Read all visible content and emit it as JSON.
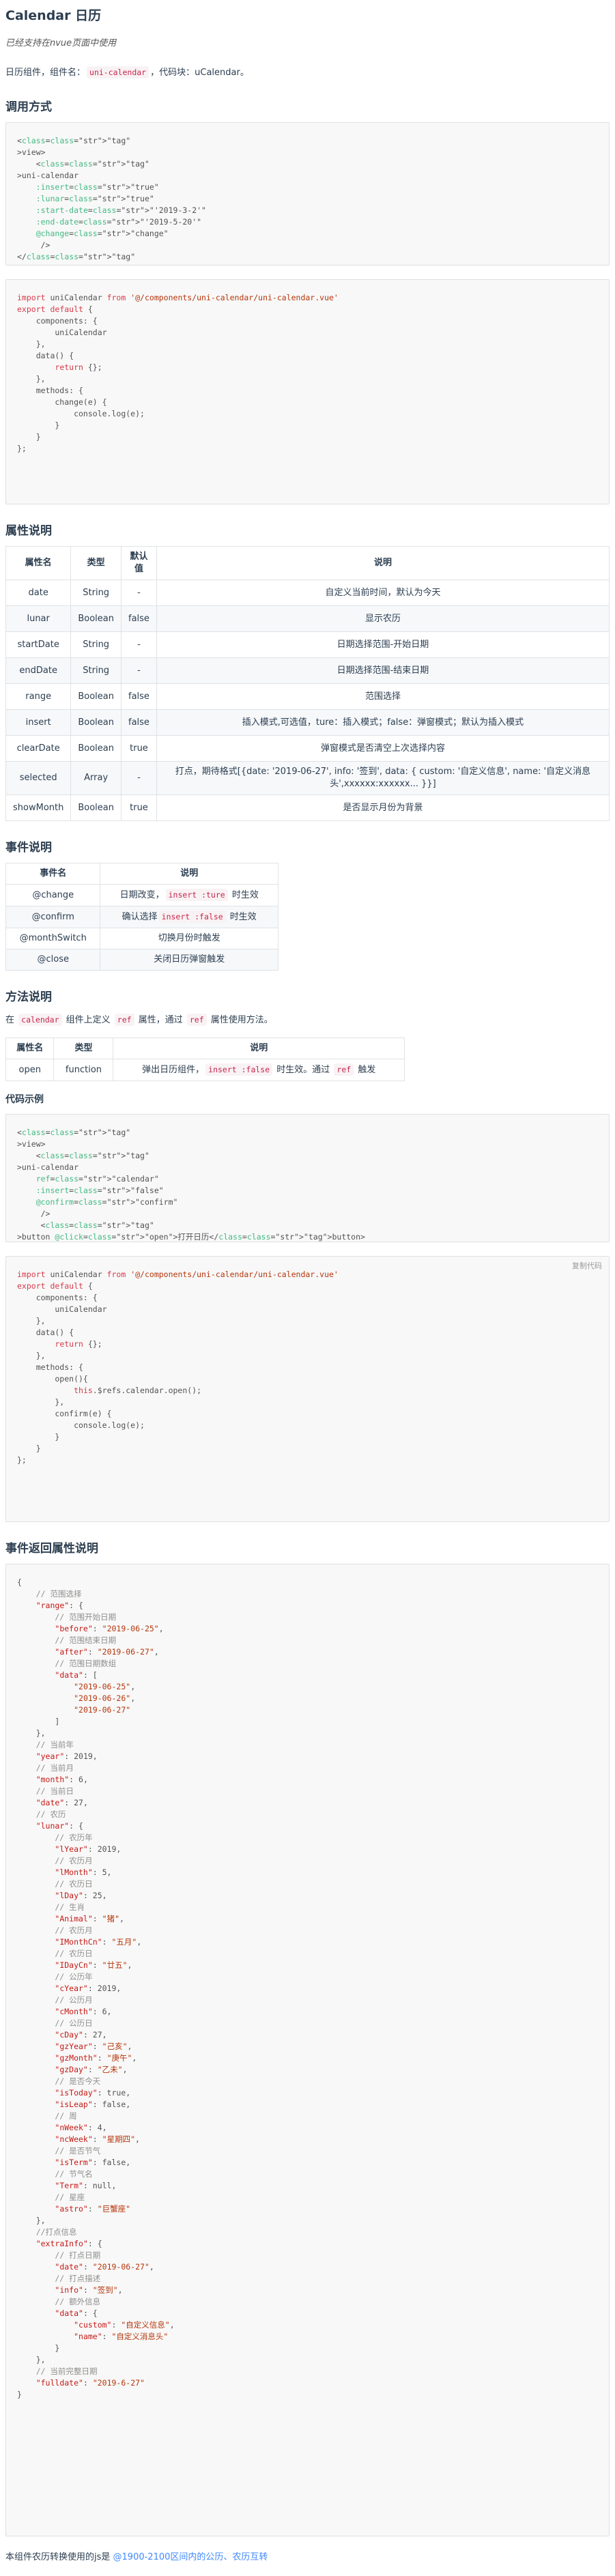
{
  "title": "Calendar 日历",
  "subtitle": "已经支持在nvue页面中使用",
  "intro": {
    "text1": "日历组件，组件名：",
    "comp_name": "uni-calendar",
    "text2": "，代码块：",
    "snippet": "uCalendar",
    "text3": "。"
  },
  "section_usage": "调用方式",
  "usage_template_lines": [
    "<view>",
    "    <uni-calendar",
    "    :insert=\"true\"",
    "    :lunar=\"true\"",
    "    :start-date=\"'2019-3-2'\"",
    "    :end-date=\"'2019-5-20'\"",
    "    @change=\"change\"",
    "     />",
    "</view>"
  ],
  "usage_script_lines": [
    "import uniCalendar from '@/components/uni-calendar/uni-calendar.vue'",
    "export default {",
    "    components: {",
    "        uniCalendar",
    "    },",
    "    data() {",
    "        return {};",
    "    },",
    "    methods: {",
    "        change(e) {",
    "            console.log(e);",
    "        }",
    "    }",
    "};"
  ],
  "section_props": "属性说明",
  "props_headers": [
    "属性名",
    "类型",
    "默认值",
    "说明"
  ],
  "props_rows": [
    [
      "date",
      "String",
      "-",
      "自定义当前时间，默认为今天"
    ],
    [
      "lunar",
      "Boolean",
      "false",
      "显示农历"
    ],
    [
      "startDate",
      "String",
      "-",
      "日期选择范围-开始日期"
    ],
    [
      "endDate",
      "String",
      "-",
      "日期选择范围-结束日期"
    ],
    [
      "range",
      "Boolean",
      "false",
      "范围选择"
    ],
    [
      "insert",
      "Boolean",
      "false",
      "插入模式,可选值，ture：插入模式；false：弹窗模式；默认为插入模式"
    ],
    [
      "clearDate",
      "Boolean",
      "true",
      "弹窗模式是否清空上次选择内容"
    ],
    [
      "selected",
      "Array",
      "-",
      "打点，期待格式[{date: '2019-06-27', info: '签到', data: { custom: '自定义信息', name: '自定义消息头',xxxxxx:xxxxxx... }}]"
    ],
    [
      "showMonth",
      "Boolean",
      "true",
      "是否显示月份为背景"
    ]
  ],
  "section_events": "事件说明",
  "events_headers": [
    "事件名",
    "说明"
  ],
  "events_rows": [
    {
      "name": "@change",
      "pre": "日期改变，",
      "code": "insert :ture",
      "post": " 时生效"
    },
    {
      "name": "@confirm",
      "pre": "确认选择",
      "code": "insert :false",
      "post": " 时生效"
    },
    {
      "name": "@monthSwitch",
      "pre": "切换月份时触发",
      "code": "",
      "post": ""
    },
    {
      "name": "@close",
      "pre": "关闭日历弹窗触发",
      "code": "",
      "post": ""
    }
  ],
  "section_methods": "方法说明",
  "methods_intro": {
    "t1": "在 ",
    "c1": "calendar",
    "t2": " 组件上定义 ",
    "c2": "ref",
    "t3": " 属性，通过 ",
    "c3": "ref",
    "t4": " 属性使用方法。"
  },
  "methods_headers": [
    "属性名",
    "类型",
    "说明"
  ],
  "methods_row": {
    "name": "open",
    "type": "function",
    "pre": "弹出日历组件，",
    "code": "insert :false",
    "mid": " 时生效。通过 ",
    "code2": "ref",
    "post": " 触发"
  },
  "section_example": "代码示例",
  "example_template_lines": [
    "<view>",
    "    <uni-calendar",
    "    ref=\"calendar\"",
    "    :insert=\"false\"",
    "    @confirm=\"confirm\"",
    "     />",
    "     <button @click=\"open\">打开日历</button>",
    "</view>"
  ],
  "copy_label": "复制代码",
  "example_script_lines": [
    "import uniCalendar from '@/components/uni-calendar/uni-calendar.vue'",
    "export default {",
    "    components: {",
    "        uniCalendar",
    "    },",
    "    data() {",
    "        return {};",
    "    },",
    "    methods: {",
    "        open(){",
    "            this.$refs.calendar.open();",
    "        },",
    "        confirm(e) {",
    "            console.log(e);",
    "        }",
    "    }",
    "};"
  ],
  "section_return": "事件返回属性说明",
  "return_lines": [
    "{",
    "    // 范围选择",
    "    \"range\": {",
    "        // 范围开始日期",
    "        \"before\": \"2019-06-25\",",
    "        // 范围结束日期",
    "        \"after\": \"2019-06-27\",",
    "        // 范围日期数组",
    "        \"data\": [",
    "            \"2019-06-25\",",
    "            \"2019-06-26\",",
    "            \"2019-06-27\"",
    "        ]",
    "    },",
    "    // 当前年",
    "    \"year\": 2019,",
    "    // 当前月",
    "    \"month\": 6,",
    "    // 当前日",
    "    \"date\": 27,",
    "    // 农历",
    "    \"lunar\": {",
    "        // 农历年",
    "        \"lYear\": 2019,",
    "        // 农历月",
    "        \"lMonth\": 5,",
    "        // 农历日",
    "        \"lDay\": 25,",
    "        // 生肖",
    "        \"Animal\": \"猪\",",
    "        // 农历月",
    "        \"IMonthCn\": \"五月\",",
    "        // 农历日",
    "        \"IDayCn\": \"廿五\",",
    "        // 公历年",
    "        \"cYear\": 2019,",
    "        // 公历月",
    "        \"cMonth\": 6,",
    "        // 公历日",
    "        \"cDay\": 27,",
    "        \"gzYear\": \"己亥\",",
    "        \"gzMonth\": \"庚午\",",
    "        \"gzDay\": \"乙未\",",
    "        // 是否今天",
    "        \"isToday\": true,",
    "        \"isLeap\": false,",
    "        // 周",
    "        \"nWeek\": 4,",
    "        \"ncWeek\": \"星期四\",",
    "        // 是否节气",
    "        \"isTerm\": false,",
    "        // 节气名",
    "        \"Term\": null,",
    "        // 星座",
    "        \"astro\": \"巨蟹座\"",
    "    },",
    "    //打点信息",
    "    \"extraInfo\": {",
    "        // 打点日期",
    "        \"date\": \"2019-06-27\",",
    "        // 打点描述",
    "        \"info\": \"签到\",",
    "        // 额外信息",
    "        \"data\": {",
    "            \"custom\": \"自定义信息\",",
    "            \"name\": \"自定义消息头\"",
    "        }",
    "    },",
    "    // 当前完整日期",
    "    \"fulldate\": \"2019-6-27\"",
    "}"
  ],
  "footer": {
    "text": "本组件农历转换使用的js是 ",
    "link": "@1900-2100区间内的公历、农历互转"
  }
}
